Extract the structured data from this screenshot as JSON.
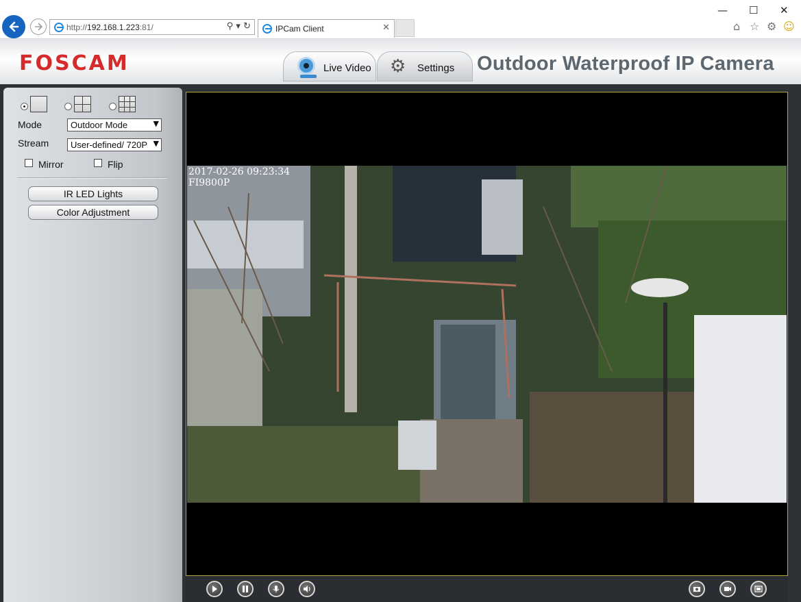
{
  "browser": {
    "url_prefix": "http://",
    "url_host": "192.168.1.223",
    "url_suffix": ":81/",
    "tab_title": "IPCam Client",
    "nav_icons": [
      "back-arrow-icon",
      "forward-arrow-icon"
    ],
    "address_icons": [
      "search-icon",
      "dropdown-icon",
      "refresh-icon"
    ],
    "window_buttons": [
      "minimize-icon",
      "maximize-icon",
      "close-icon"
    ],
    "toolbar_icons": [
      "home-icon",
      "favorites-star-icon",
      "gear-icon",
      "smiley-icon"
    ]
  },
  "header": {
    "logo": "FOSCAM",
    "tabs": [
      {
        "label": "Live Video",
        "icon": "webcam-icon",
        "active": true
      },
      {
        "label": "Settings",
        "icon": "tools-icon",
        "active": false
      }
    ],
    "product_title": "Outdoor Waterproof IP Camera"
  },
  "sidebar": {
    "layouts": [
      {
        "icon": "single-view-icon",
        "selected": true
      },
      {
        "icon": "four-view-icon",
        "selected": false
      },
      {
        "icon": "nine-view-icon",
        "selected": false
      }
    ],
    "mode": {
      "label": "Mode",
      "value": "Outdoor Mode"
    },
    "stream": {
      "label": "Stream",
      "value": "User-defined/ 720P"
    },
    "mirror": {
      "label": "Mirror",
      "checked": false
    },
    "flip": {
      "label": "Flip",
      "checked": false
    },
    "buttons": {
      "ir": "IR LED Lights",
      "color": "Color Adjustment"
    }
  },
  "video": {
    "timestamp": "2017-02-26 09:23:34",
    "camera_name": "FI9800P"
  },
  "controls": {
    "left": [
      "play-icon",
      "pause-icon",
      "record-icon",
      "audio-icon"
    ],
    "right": [
      "snapshot-icon",
      "record-video-icon",
      "fullscreen-icon"
    ]
  },
  "colors": {
    "brand": "#d62b2b",
    "accent": "#1565c0"
  }
}
